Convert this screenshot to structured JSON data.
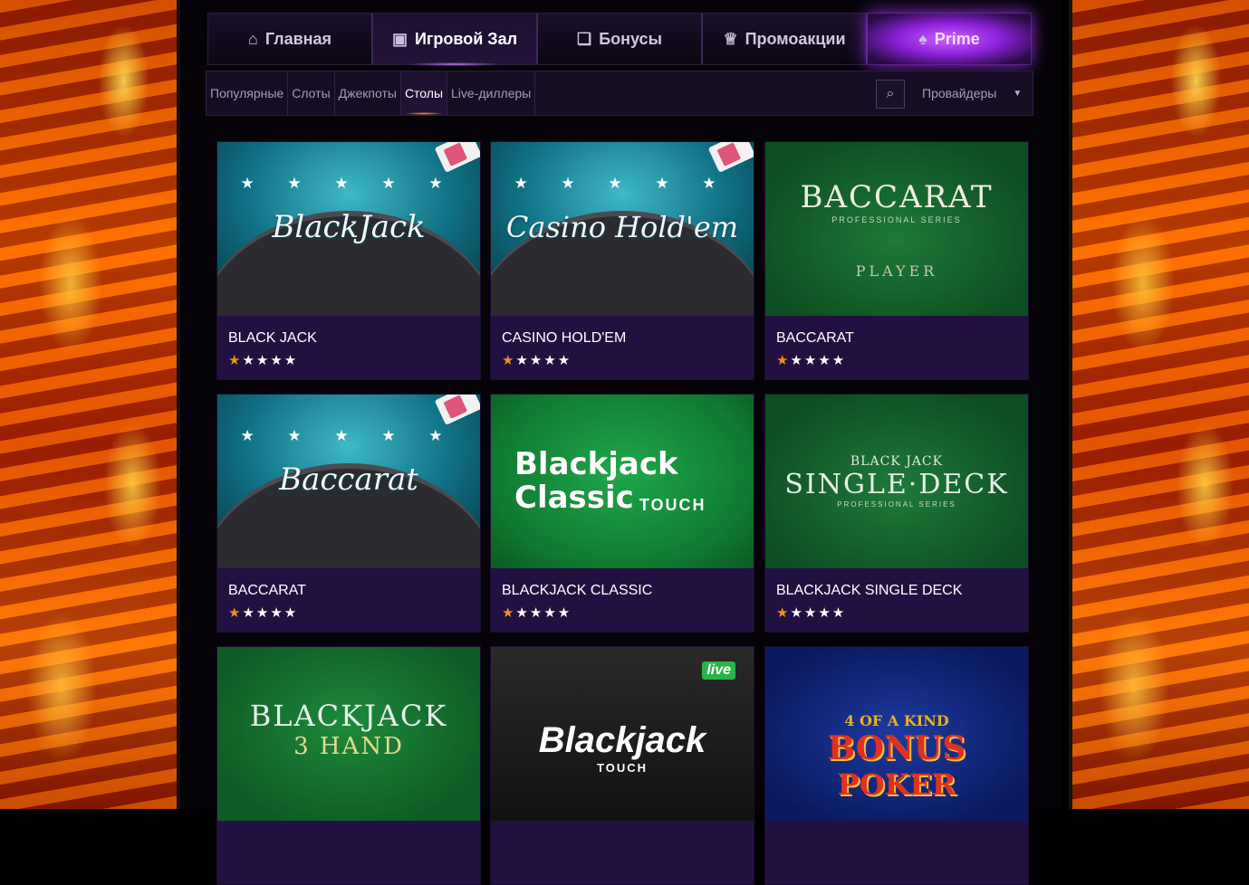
{
  "topnav": {
    "tabs": [
      {
        "label": "Главная",
        "icon": "home-icon"
      },
      {
        "label": "Игровой Зал",
        "icon": "slot-machine-icon"
      },
      {
        "label": "Бонусы",
        "icon": "gift-icon"
      },
      {
        "label": "Промоакции",
        "icon": "trophy-icon"
      },
      {
        "label": "Prime",
        "icon": "spade-icon"
      }
    ]
  },
  "subnav": {
    "items": [
      "Популярные",
      "Слоты",
      "Джекпоты",
      "Столы",
      "Live-диллеры"
    ],
    "active": "Столы",
    "providers_label": "Провайдеры"
  },
  "games": [
    {
      "title": "BLACK JACK",
      "art": "BlackJack",
      "rating": "★★★★★"
    },
    {
      "title": "CASINO HOLD'EM",
      "art": "Casino Hold'em",
      "rating": "★★★★★"
    },
    {
      "title": "BACCARAT",
      "art": "BACCARAT",
      "art_sub": "PROFESSIONAL SERIES",
      "art_sub2": "PLAYER",
      "rating": "★★★★★"
    },
    {
      "title": "BACCARAT",
      "art": "Baccarat",
      "rating": "★★★★★"
    },
    {
      "title": "BLACKJACK CLASSIC",
      "art": "Blackjack",
      "art_sub": "Classic",
      "art_sub2": "TOUCH",
      "rating": "★★★★★"
    },
    {
      "title": "BLACKJACK SINGLE DECK",
      "art": "SINGLE·DECK",
      "art_sub": "BLACK JACK",
      "art_sub2": "PROFESSIONAL SERIES",
      "rating": "★★★★★"
    },
    {
      "title": "",
      "art": "BLACKJACK",
      "art_sub": "3 HAND",
      "rating": ""
    },
    {
      "title": "",
      "art": "Blackjack",
      "art_sub": "TOUCH",
      "badge": "live",
      "rating": ""
    },
    {
      "title": "",
      "art": "BONUS",
      "art_sub": "4 OF A KIND",
      "art_sub2": "POKER",
      "rating": ""
    }
  ],
  "stars_decor": "★ ★ ★ ★ ★",
  "colors": {
    "accent": "#a030f0",
    "card_bg": "#221140",
    "star_first": "#f09020"
  }
}
